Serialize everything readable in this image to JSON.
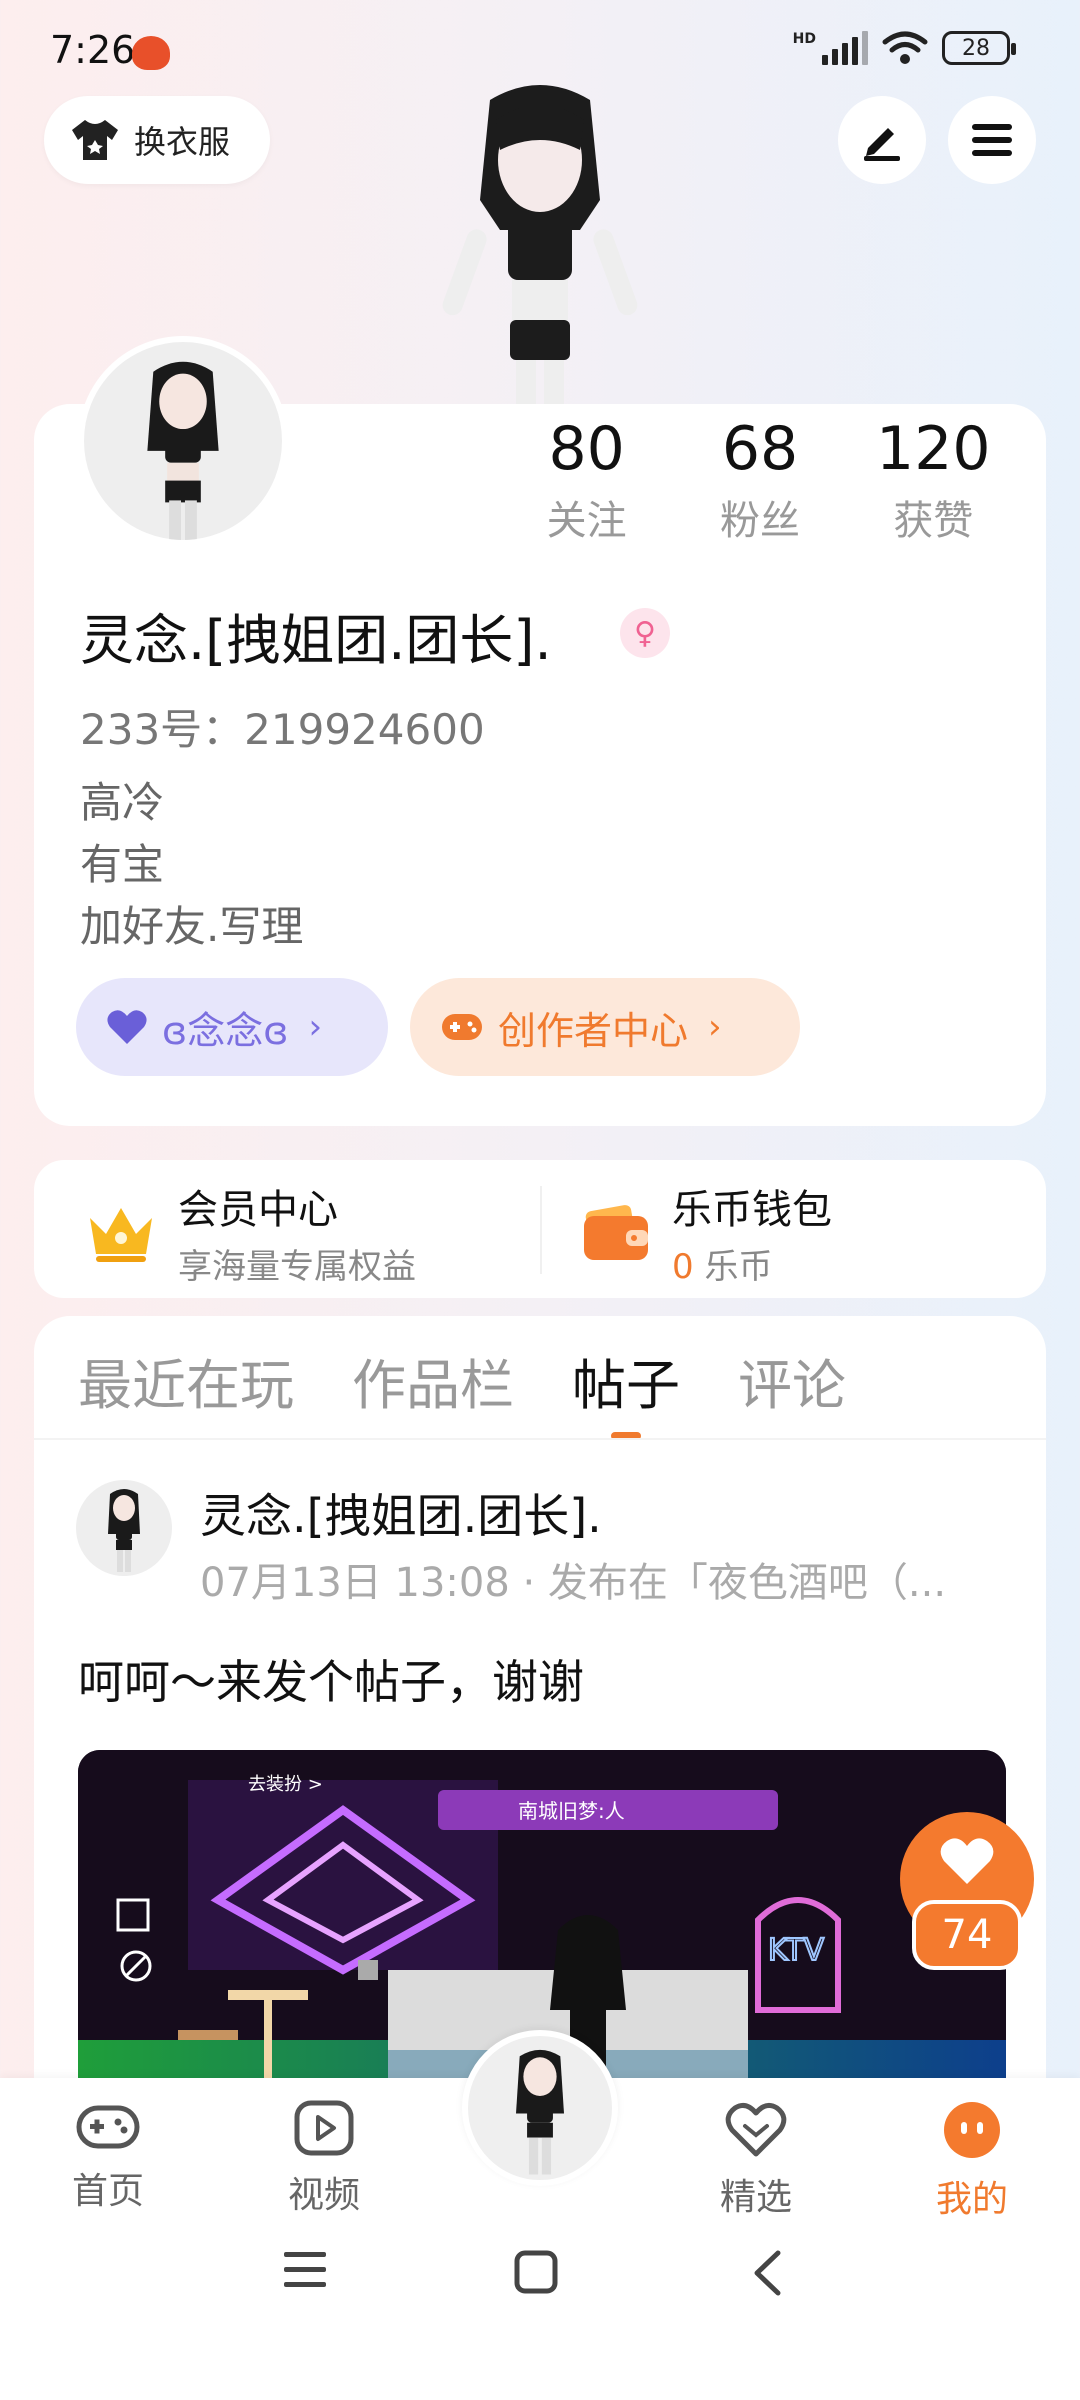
{
  "status": {
    "time": "7:26",
    "hd": "HD",
    "battery": "28"
  },
  "top": {
    "outfit_label": "换衣服"
  },
  "stats": [
    {
      "num": "80",
      "label": "关注"
    },
    {
      "num": "68",
      "label": "粉丝"
    },
    {
      "num": "120",
      "label": "获赞"
    }
  ],
  "profile": {
    "nickname": "灵念.[拽姐团.团长].",
    "gender_icon": "female-icon",
    "uid": "233号：219924600",
    "bio": [
      "高冷",
      "有宝",
      "加好友.写理"
    ],
    "fan_chip": "ɞ念念ɞ",
    "creator_chip": "创作者中心"
  },
  "member": {
    "vip_title": "会员中心",
    "vip_sub": "享海量专属权益",
    "wallet_title": "乐币钱包",
    "wallet_amount": "0",
    "wallet_unit": "乐币"
  },
  "tabs": [
    "最近在玩",
    "作品栏",
    "帖子",
    "评论"
  ],
  "active_tab": "帖子",
  "post": {
    "author": "灵念.[拽姐团.团长].",
    "meta": "07月13日 13:08 · 发布在「夜色酒吧（...",
    "text": "呵呵～来发个帖子，谢谢",
    "image_labels": {
      "dress_up": "去装扮 >",
      "banner": "南城旧梦:人",
      "ktv": "KTV"
    },
    "likes": "74"
  },
  "nav": [
    {
      "label": "首页",
      "icon": "gamepad-icon"
    },
    {
      "label": "视频",
      "icon": "play-icon"
    },
    {
      "label": "精选",
      "icon": "heart-chat-icon"
    },
    {
      "label": "我的",
      "icon": "smile-icon"
    }
  ],
  "colors": {
    "accent": "#f07a2e",
    "purple": "#7b6fe0"
  }
}
